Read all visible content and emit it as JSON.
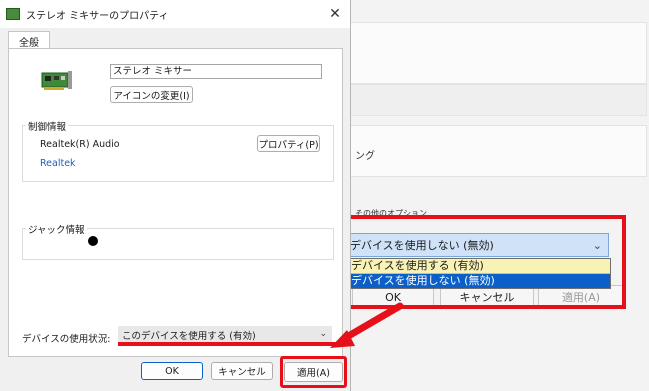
{
  "background": {
    "text_ng": "ング",
    "text_partial_option": "その他のオプション",
    "ok_label": "OK",
    "cancel_label": "キャンセル",
    "apply_label": "適用(A)"
  },
  "popup_select": {
    "current": "このデバイスを使用しない (無効)",
    "options": [
      "このデバイスを使用する (有効)",
      "このデバイスを使用しない (無効)"
    ]
  },
  "dialog": {
    "title": "ステレオ ミキサーのプロパティ",
    "tab_label": "全般",
    "device_name": "ステレオ ミキサー",
    "change_icon_button": "アイコンの変更(I)",
    "control_group_label": "制御情報",
    "controller_name": "Realtek(R) Audio",
    "properties_button": "プロパティ(P)",
    "vendor_link": "Realtek",
    "jack_group_label": "ジャック情報",
    "usage_label": "デバイスの使用状況:",
    "usage_value": "このデバイスを使用する (有効)",
    "ok_button": "OK",
    "cancel_button": "キャンセル",
    "apply_button": "適用(A)"
  },
  "colors": {
    "highlight": "#e6101a",
    "selected_option": "#0a60c8",
    "hover_option": "#f9f2b5",
    "link": "#1f5fbf"
  }
}
